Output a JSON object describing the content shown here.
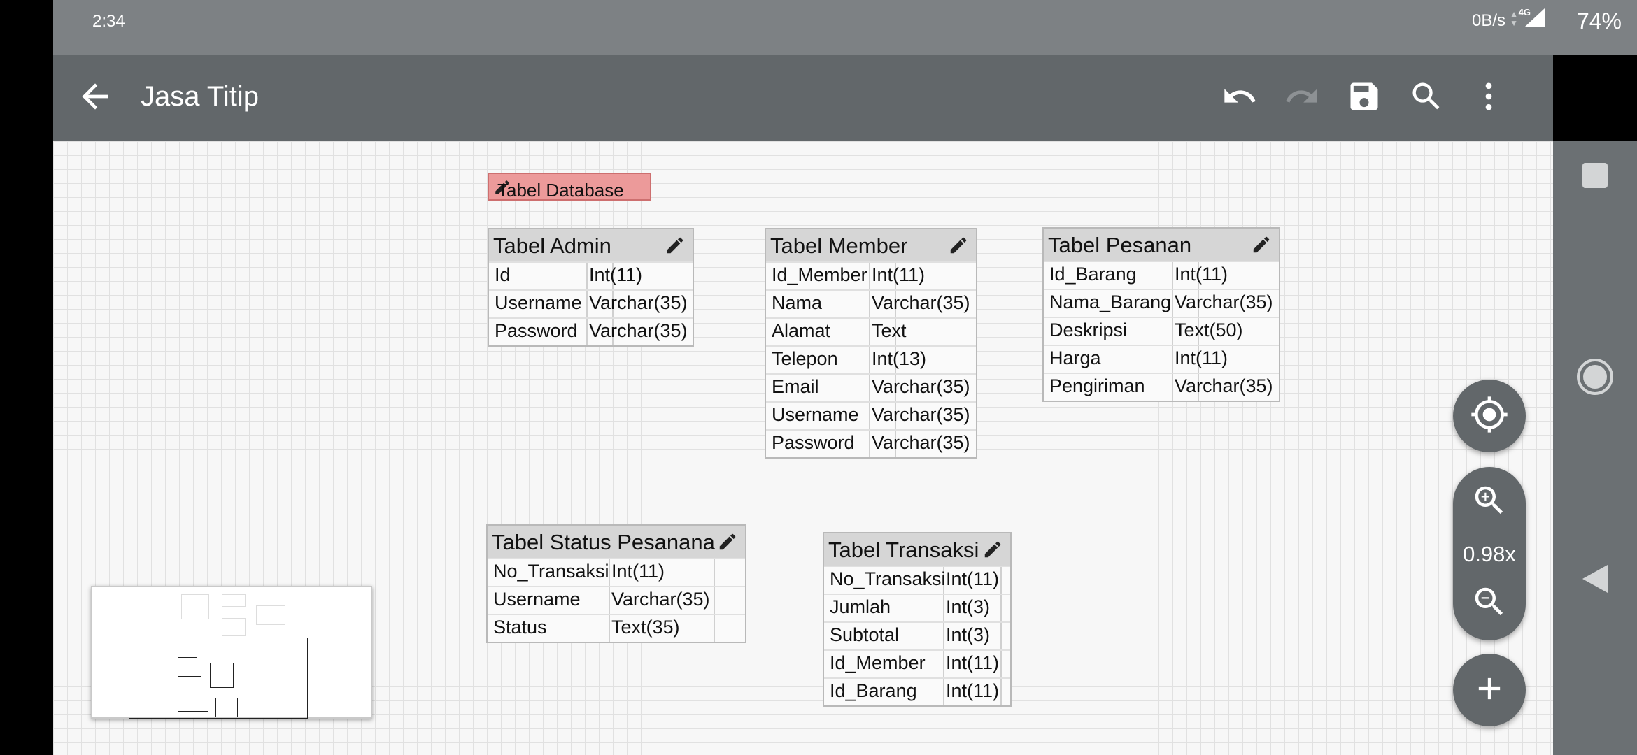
{
  "status": {
    "time": "2:34",
    "net": "0B/s",
    "network_type": "4G",
    "battery": "74%"
  },
  "appbar": {
    "title": "Jasa Titip",
    "icons": [
      "back-arrow-icon",
      "undo-icon",
      "redo-icon",
      "save-icon",
      "search-icon",
      "more-vert-icon"
    ]
  },
  "note": {
    "label": "Tabel Database",
    "color": "#ec9a9a"
  },
  "tables": {
    "admin": {
      "title": "Tabel Admin",
      "rows": [
        [
          "Id",
          "Int(11)"
        ],
        [
          "Username",
          "Varchar(35)"
        ],
        [
          "Password",
          "Varchar(35)"
        ]
      ]
    },
    "member": {
      "title": "Tabel Member",
      "rows": [
        [
          "Id_Member",
          "Int(11)"
        ],
        [
          "Nama",
          "Varchar(35)"
        ],
        [
          "Alamat",
          "Text"
        ],
        [
          "Telepon",
          "Int(13)"
        ],
        [
          "Email",
          "Varchar(35)"
        ],
        [
          "Username",
          "Varchar(35)"
        ],
        [
          "Password",
          "Varchar(35)"
        ]
      ]
    },
    "pesanan": {
      "title": "Tabel Pesanan",
      "rows": [
        [
          "Id_Barang",
          "Int(11)"
        ],
        [
          "Nama_Barang",
          "Varchar(35)"
        ],
        [
          "Deskripsi",
          "Text(50)"
        ],
        [
          "Harga",
          "Int(11)"
        ],
        [
          "Pengiriman",
          "Varchar(35)"
        ]
      ]
    },
    "status": {
      "title": "Tabel Status Pesanana",
      "rows": [
        [
          "No_Transaksi",
          "Int(11)"
        ],
        [
          "Username",
          "Varchar(35)"
        ],
        [
          "Status",
          "Text(35)"
        ]
      ]
    },
    "transaksi": {
      "title": "Tabel Transaksi",
      "rows": [
        [
          "No_Transaksi",
          "Int(11)"
        ],
        [
          "Jumlah",
          "Int(3)"
        ],
        [
          "Subtotal",
          "Int(3)"
        ],
        [
          "Id_Member",
          "Int(11)"
        ],
        [
          "Id_Barang",
          "Int(11)"
        ]
      ]
    }
  },
  "zoom": {
    "level": "0.98x"
  },
  "colors": {
    "appbar": "#62676a",
    "statusbar": "#7d8184",
    "navbar": "#6b7073",
    "header": "#d6d6d6"
  }
}
